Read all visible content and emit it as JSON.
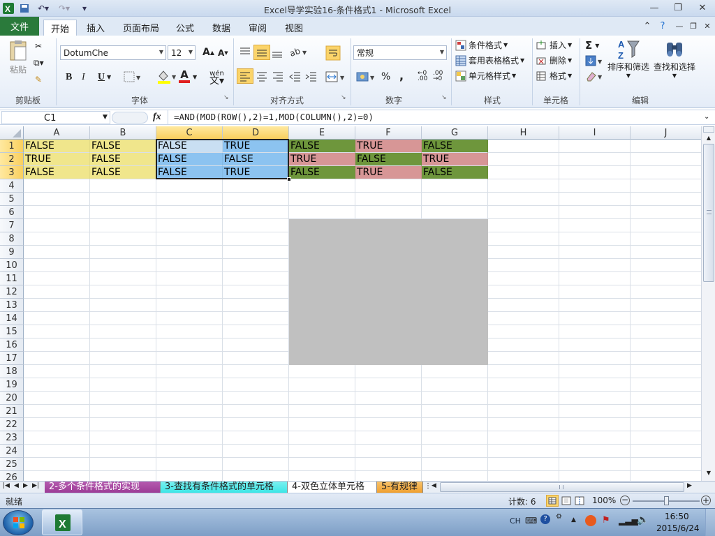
{
  "window": {
    "title": "Excel导学实验16-条件格式1 - Microsoft Excel"
  },
  "ribbon": {
    "tabs": [
      "文件",
      "开始",
      "插入",
      "页面布局",
      "公式",
      "数据",
      "审阅",
      "视图"
    ],
    "active_tab": "开始",
    "clipboard": {
      "paste_label": "粘贴",
      "group": "剪贴板"
    },
    "font": {
      "name": "DotumChe",
      "size": "12",
      "group": "字体",
      "bold": "B",
      "italic": "I",
      "underline": "U",
      "font_color_glyph": "A",
      "wen_glyph": "wén"
    },
    "align": {
      "group": "对齐方式"
    },
    "number": {
      "format": "常规",
      "group": "数字",
      "percent": "%",
      "comma": ","
    },
    "styles": {
      "cond_format": "条件格式",
      "table_format": "套用表格格式",
      "cell_styles": "单元格样式",
      "group": "样式"
    },
    "cells": {
      "insert": "插入",
      "delete": "删除",
      "format": "格式",
      "group": "单元格"
    },
    "editing": {
      "sum_glyph": "Σ",
      "sort_filter": "排序和筛选",
      "find_select": "查找和选择",
      "group": "编辑"
    }
  },
  "formula_bar": {
    "name_box": "C1",
    "fx": "fx",
    "formula": "=AND(MOD(ROW(),2)=1,MOD(COLUMN(),2)=0)"
  },
  "sheet": {
    "columns": [
      "A",
      "B",
      "C",
      "D",
      "E",
      "F",
      "G",
      "H",
      "I",
      "J"
    ],
    "rows": [
      "1",
      "2",
      "3",
      "4",
      "5",
      "6",
      "7",
      "8",
      "9",
      "10",
      "11",
      "12",
      "13",
      "14",
      "15",
      "16",
      "17",
      "18",
      "19",
      "20",
      "21",
      "22",
      "23",
      "24",
      "25",
      "26"
    ],
    "cells": [
      [
        "FALSE",
        "FALSE",
        "FALSE",
        "TRUE",
        "FALSE",
        "TRUE",
        "FALSE"
      ],
      [
        "TRUE",
        "FALSE",
        "FALSE",
        "FALSE",
        "TRUE",
        "FALSE",
        "TRUE"
      ],
      [
        "FALSE",
        "FALSE",
        "FALSE",
        "TRUE",
        "FALSE",
        "TRUE",
        "FALSE"
      ]
    ],
    "colors": {
      "yellow": "#f0e68c",
      "blue": "#8cc3f0",
      "active_cell": "#c9dff2",
      "olive": "#6e963c",
      "pink": "#d79696",
      "gray": "#c0c0c0"
    }
  },
  "sheet_tabs": [
    {
      "label": "2-多个条件格式的实现",
      "color": "#9c3c96"
    },
    {
      "label": "3-查找有条件格式的单元格",
      "color": "#3ce6e6"
    },
    {
      "label": "4-双色立体单元格",
      "color": "#ffffff"
    },
    {
      "label": "5-有规律",
      "color": "#f0a030"
    }
  ],
  "status": {
    "ready": "就绪",
    "count": "计数: 6",
    "zoom": "100%"
  },
  "taskbar": {
    "lang": "CH",
    "time": "16:50",
    "date": "2015/6/24"
  }
}
